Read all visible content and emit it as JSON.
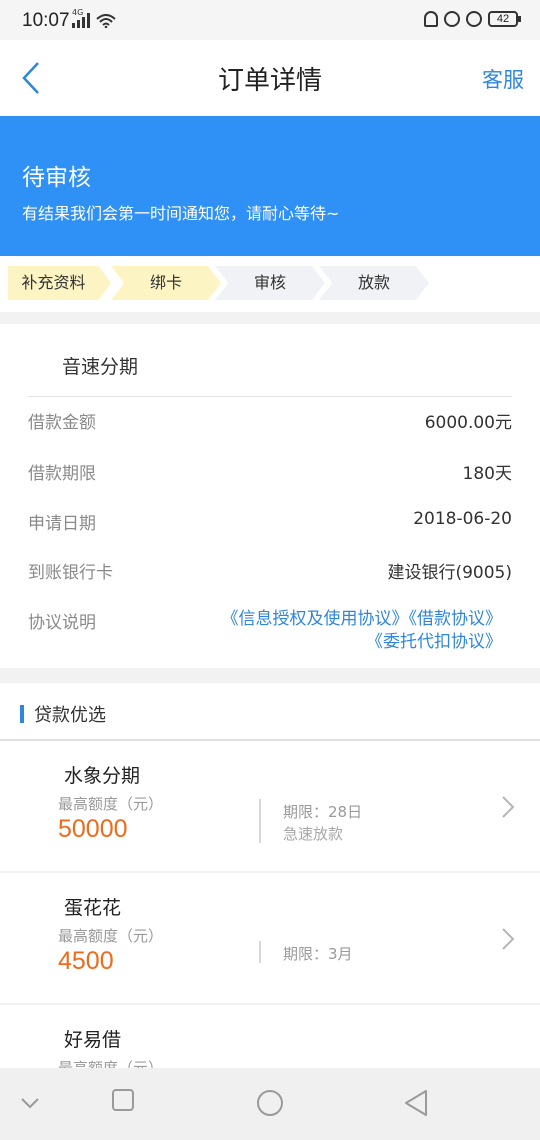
{
  "status_bar": {
    "time": "10:07",
    "network": "4G",
    "battery": "42"
  },
  "nav": {
    "title": "订单详情",
    "service": "客服"
  },
  "banner": {
    "title": "待审核",
    "description": "有结果我们会第一时间通知您，请耐心等待~"
  },
  "steps": [
    {
      "label": "补充资料",
      "state": "done"
    },
    {
      "label": "绑卡",
      "state": "done"
    },
    {
      "label": "审核",
      "state": "todo"
    },
    {
      "label": "放款",
      "state": "todo"
    }
  ],
  "order": {
    "product": "音速分期",
    "rows": [
      {
        "label": "借款金额",
        "value": "6000.00元"
      },
      {
        "label": "借款期限",
        "value": "180天"
      },
      {
        "label": "申请日期",
        "value": "2018-06-20"
      },
      {
        "label": "到账银行卡",
        "value": "建设银行(9005)"
      },
      {
        "label": "协议说明",
        "value": ""
      }
    ],
    "agreements": [
      "《信息授权及使用协议》",
      "《借款协议》",
      "《委托代扣协议》"
    ]
  },
  "recommend": {
    "title": "贷款优选",
    "items": [
      {
        "name": "水象分期",
        "quota_label": "最高额度（元）",
        "amount": "50000",
        "term": "期限：28日",
        "note": "急速放款"
      },
      {
        "name": "蛋花花",
        "quota_label": "最高额度（元）",
        "amount": "4500",
        "term": "期限：3月",
        "note": ""
      },
      {
        "name": "好易借",
        "quota_label": "最高额度（元）",
        "amount": "",
        "term": "",
        "note": ""
      }
    ]
  },
  "colors": {
    "accent": "#2f90f5",
    "link": "#2f86df",
    "amount": "#ef6a1a",
    "step_done": "#fdf4c3",
    "step_todo": "#f0f2f5"
  }
}
